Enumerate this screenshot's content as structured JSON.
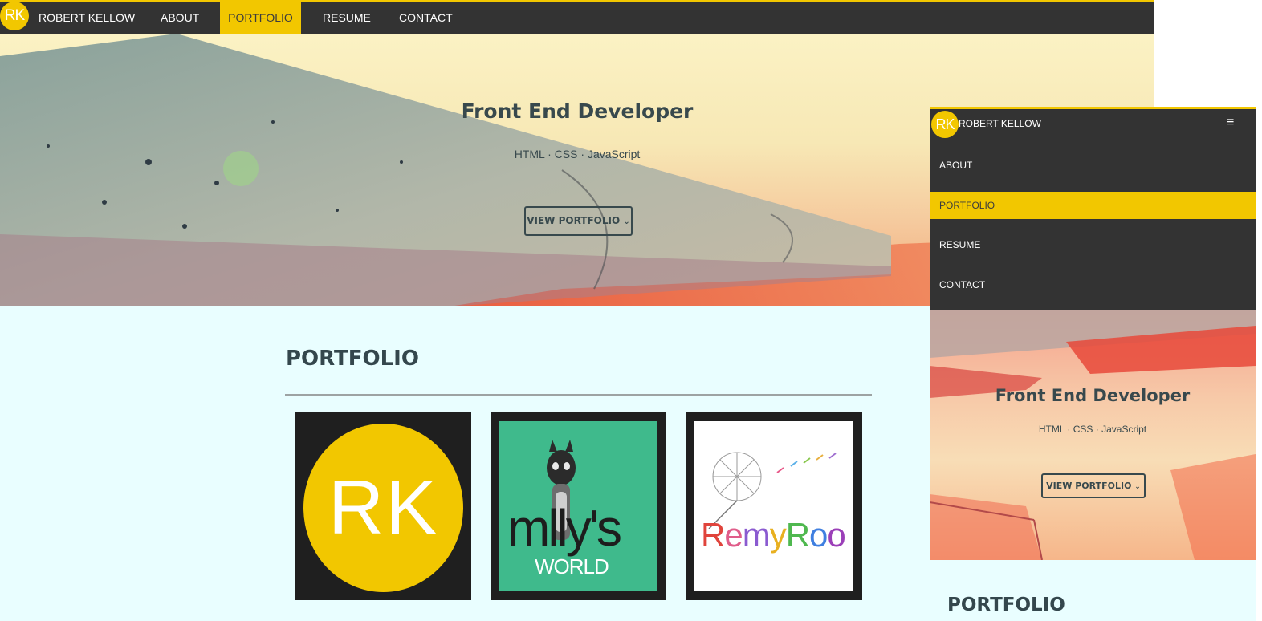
{
  "desktop": {
    "logo": "RK",
    "brand": "ROBERT KELLOW",
    "nav": [
      {
        "label": "ABOUT",
        "active": false
      },
      {
        "label": "PORTFOLIO",
        "active": true
      },
      {
        "label": "RESUME",
        "active": false
      },
      {
        "label": "CONTACT",
        "active": false
      }
    ],
    "hero": {
      "title": "Front End Developer",
      "subtitle": "HTML · CSS · JavaScript",
      "button": "VIEW PORTFOLIO"
    },
    "portfolio": {
      "title": "PORTFOLIO",
      "tiles": [
        {
          "name": "rk-logo-tile",
          "text": "RK"
        },
        {
          "name": "mollys-world-tile",
          "text_main": "mlly's",
          "text_sub": "WORLD"
        },
        {
          "name": "remyroo-tile",
          "text": "RemyRoo"
        }
      ]
    }
  },
  "mobile": {
    "logo": "RK",
    "brand": "ROBERT KELLOW",
    "menu_icon": "hamburger-icon",
    "menu_glyph": "≡",
    "nav": [
      {
        "label": "ABOUT",
        "active": false
      },
      {
        "label": "PORTFOLIO",
        "active": true
      },
      {
        "label": "RESUME",
        "active": false
      },
      {
        "label": "CONTACT",
        "active": false
      }
    ],
    "hero": {
      "title": "Front End Developer",
      "subtitle": "HTML · CSS · JavaScript",
      "button": "VIEW PORTFOLIO"
    },
    "portfolio_title": "PORTFOLIO"
  },
  "colors": {
    "accent": "#f2c700",
    "nav_bg": "#333333",
    "text_dark": "#38494d",
    "page_bg": "#e9feff",
    "tile_bg": "#1f1f1f",
    "mollys_green": "#3fba8c"
  }
}
